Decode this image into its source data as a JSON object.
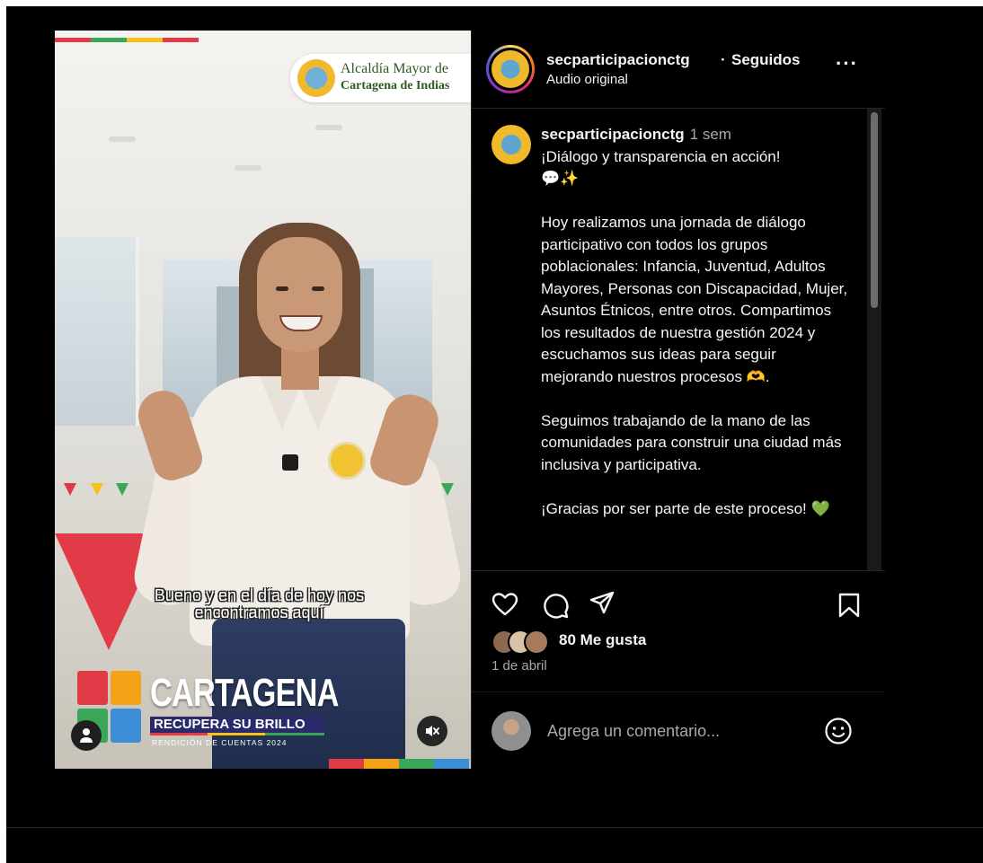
{
  "video": {
    "alcaldia_line1": "Alcaldía Mayor de",
    "alcaldia_line2": "Cartagena de Indias",
    "subtitle_line1": "Bueno y en el día de hoy nos",
    "subtitle_line2": "encontramos aquí",
    "brand_word": "CARTAGENA",
    "brand_sub": "RECUPERA SU BRILLO",
    "brand_small": "RENDICIÓN DE CUENTAS 2024",
    "user_tag_icon": "person-icon",
    "mute_icon": "speaker-muted-icon"
  },
  "header": {
    "username": "secparticipacionctg",
    "separator": "·",
    "follow_status": "Seguidos",
    "audio": "Audio original",
    "more": "···"
  },
  "caption": {
    "username": "secparticipacionctg",
    "time": "1 sem",
    "p1_line1": "¡Diálogo y transparencia en acción!",
    "p1_emoji": "💬✨",
    "p2": "Hoy realizamos una jornada de diálogo participativo con todos los grupos poblacionales: Infancia, Juventud, Adultos Mayores, Personas con Discapacidad, Mujer, Asuntos Étnicos, entre otros. Compartimos los resultados de nuestra gestión 2024 y escuchamos sus ideas para seguir mejorando nuestros procesos 🫶.",
    "p3": "Seguimos trabajando de la mano de las comunidades para construir una ciudad más inclusiva y participativa.",
    "p4": "¡Gracias por ser parte de este proceso! 💚"
  },
  "actions": {
    "likes": "80 Me gusta",
    "date": "1 de abril"
  },
  "comment": {
    "placeholder": "Agrega un comentario..."
  },
  "colors": {
    "background": "#000000",
    "text": "#f5f5f5",
    "muted_text": "#a8a8a8",
    "brand_red": "#e23b48",
    "brand_yellow": "#f6c218",
    "brand_green": "#3aa657"
  }
}
